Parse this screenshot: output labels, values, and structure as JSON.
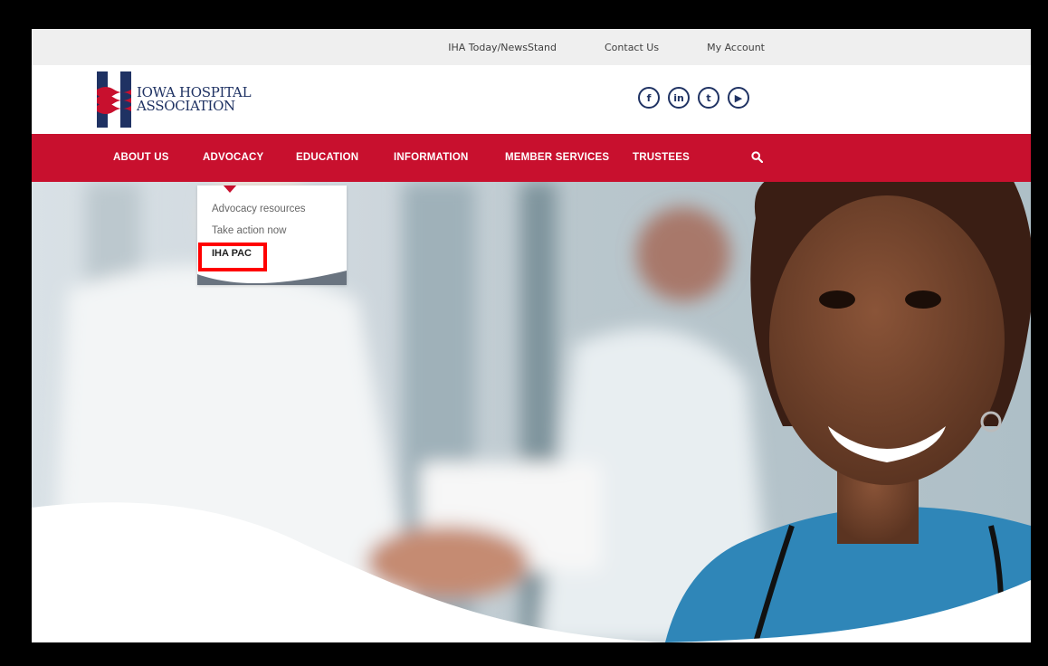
{
  "utility_links": [
    "IHA Today/NewsStand",
    "Contact Us",
    "My Account"
  ],
  "logo": {
    "line1": "Iowa Hospital",
    "line2": "Association"
  },
  "social": [
    "f",
    "in",
    "t",
    "▶"
  ],
  "social_icon_names": [
    "facebook-icon",
    "linkedin-icon",
    "twitter-icon",
    "youtube-icon"
  ],
  "nav": [
    "ABOUT US",
    "ADVOCACY",
    "EDUCATION",
    "INFORMATION",
    "MEMBER SERVICES",
    "TRUSTEES"
  ],
  "dropdown": {
    "items": [
      "Advocacy resources",
      "Take action now",
      "IHA PAC"
    ],
    "highlighted": "IHA PAC"
  },
  "colors": {
    "brand_red": "#c8102e",
    "brand_navy": "#1f3263",
    "highlight": "#ff0000"
  }
}
